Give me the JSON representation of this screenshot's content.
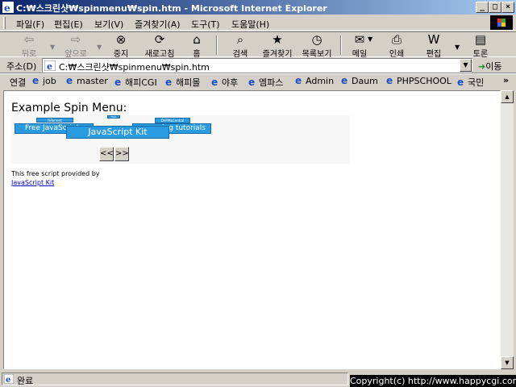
{
  "window": {
    "title": "C:₩스크린샷₩spinmenu₩spin.htm - Microsoft Internet Explorer",
    "minimize": "_",
    "maximize": "□",
    "close": "×"
  },
  "menu": {
    "items": [
      "파일(F)",
      "편집(E)",
      "보기(V)",
      "즐겨찾기(A)",
      "도구(T)",
      "도움말(H)"
    ]
  },
  "toolbar": {
    "back": "뒤로",
    "forward": "앞으로",
    "stop": "중지",
    "refresh": "새로고침",
    "home": "홈",
    "search": "검색",
    "favorites": "즐겨찾기",
    "history": "목록보기",
    "mail": "메일",
    "print": "인쇄",
    "edit": "편집",
    "discuss": "토론"
  },
  "address": {
    "label": "주소(D)",
    "value": "C:₩스크린샷₩spinmenu₩spin.htm",
    "go_label": "이동"
  },
  "links": {
    "label": "연결",
    "items": [
      "job",
      "master",
      "해피CGI",
      "해피몰",
      "야후",
      "엠파스",
      "Admin",
      "Daum",
      "PHPSCHOOL",
      "국민"
    ],
    "more": "»"
  },
  "page": {
    "heading": "Example Spin Menu:",
    "spin_items": {
      "top_left": "JSTorrent",
      "top_mid": "Help",
      "top_right": "DHTMLCentral",
      "left": "Free JavaScripts",
      "right": "ming tutorials",
      "center": "JavaScript Kit"
    },
    "prev_button": "<<",
    "next_button": ">>",
    "credit_text": "This free script provided by",
    "credit_link": "JavaScript Kit"
  },
  "status": {
    "text": "완료",
    "copyright": "Copyright(c) http://www.happycgi.com"
  },
  "colors": {
    "titlebar_start": "#0a246a",
    "titlebar_end": "#a6caf0",
    "spin_item": "#2a9be0",
    "link": "#0000cc"
  }
}
